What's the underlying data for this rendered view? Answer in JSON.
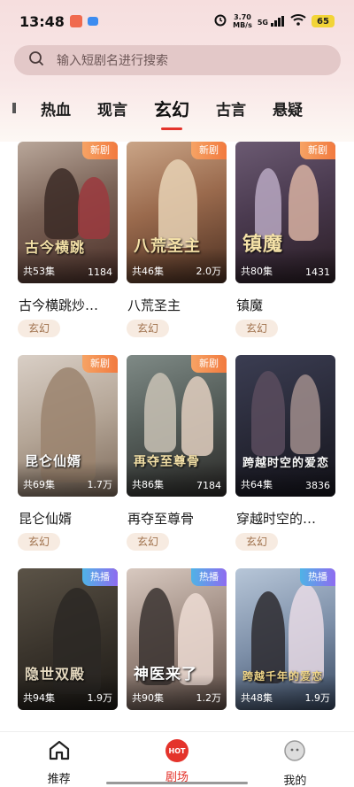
{
  "status_bar": {
    "time": "13:48",
    "net_speed_value": "3.70",
    "net_speed_unit": "MB/s",
    "signal": "5G",
    "battery": "65"
  },
  "search": {
    "placeholder": "输入短剧名进行搜索"
  },
  "tabs": [
    {
      "label": "热血"
    },
    {
      "label": "现言"
    },
    {
      "label": "玄幻",
      "active": true
    },
    {
      "label": "古言"
    },
    {
      "label": "悬疑"
    }
  ],
  "cards": [
    {
      "title": "古今横跳炒…",
      "episodes": "共53集",
      "count": "1184",
      "badge": "新剧",
      "tag": "玄幻",
      "art": "古今横跳"
    },
    {
      "title": "八荒圣主",
      "episodes": "共46集",
      "count": "2.0万",
      "badge": "新剧",
      "tag": "玄幻",
      "art": "八荒圣主"
    },
    {
      "title": "镇魔",
      "episodes": "共80集",
      "count": "1431",
      "badge": "新剧",
      "tag": "玄幻",
      "art": "镇魔"
    },
    {
      "title": "昆仑仙婿",
      "episodes": "共69集",
      "count": "1.7万",
      "badge": "新剧",
      "tag": "玄幻",
      "art": "昆仑仙婿"
    },
    {
      "title": "再夺至尊骨",
      "episodes": "共86集",
      "count": "7184",
      "badge": "新剧",
      "tag": "玄幻",
      "art": "再夺至尊骨"
    },
    {
      "title": "穿越时空的…",
      "episodes": "共64集",
      "count": "3836",
      "badge": "",
      "tag": "玄幻",
      "art": "跨越时空的爱恋"
    },
    {
      "title": "",
      "episodes": "共94集",
      "count": "1.9万",
      "badge": "热播",
      "tag": "",
      "art": "隐世双殿"
    },
    {
      "title": "",
      "episodes": "共90集",
      "count": "1.2万",
      "badge": "热播",
      "tag": "",
      "art": "神医来了"
    },
    {
      "title": "",
      "episodes": "共48集",
      "count": "1.9万",
      "badge": "热播",
      "tag": "",
      "art": "跨越千年的爱恋"
    }
  ],
  "bottom_nav": {
    "home": "推荐",
    "theater": "剧场",
    "theater_badge": "HOT",
    "me": "我的"
  }
}
